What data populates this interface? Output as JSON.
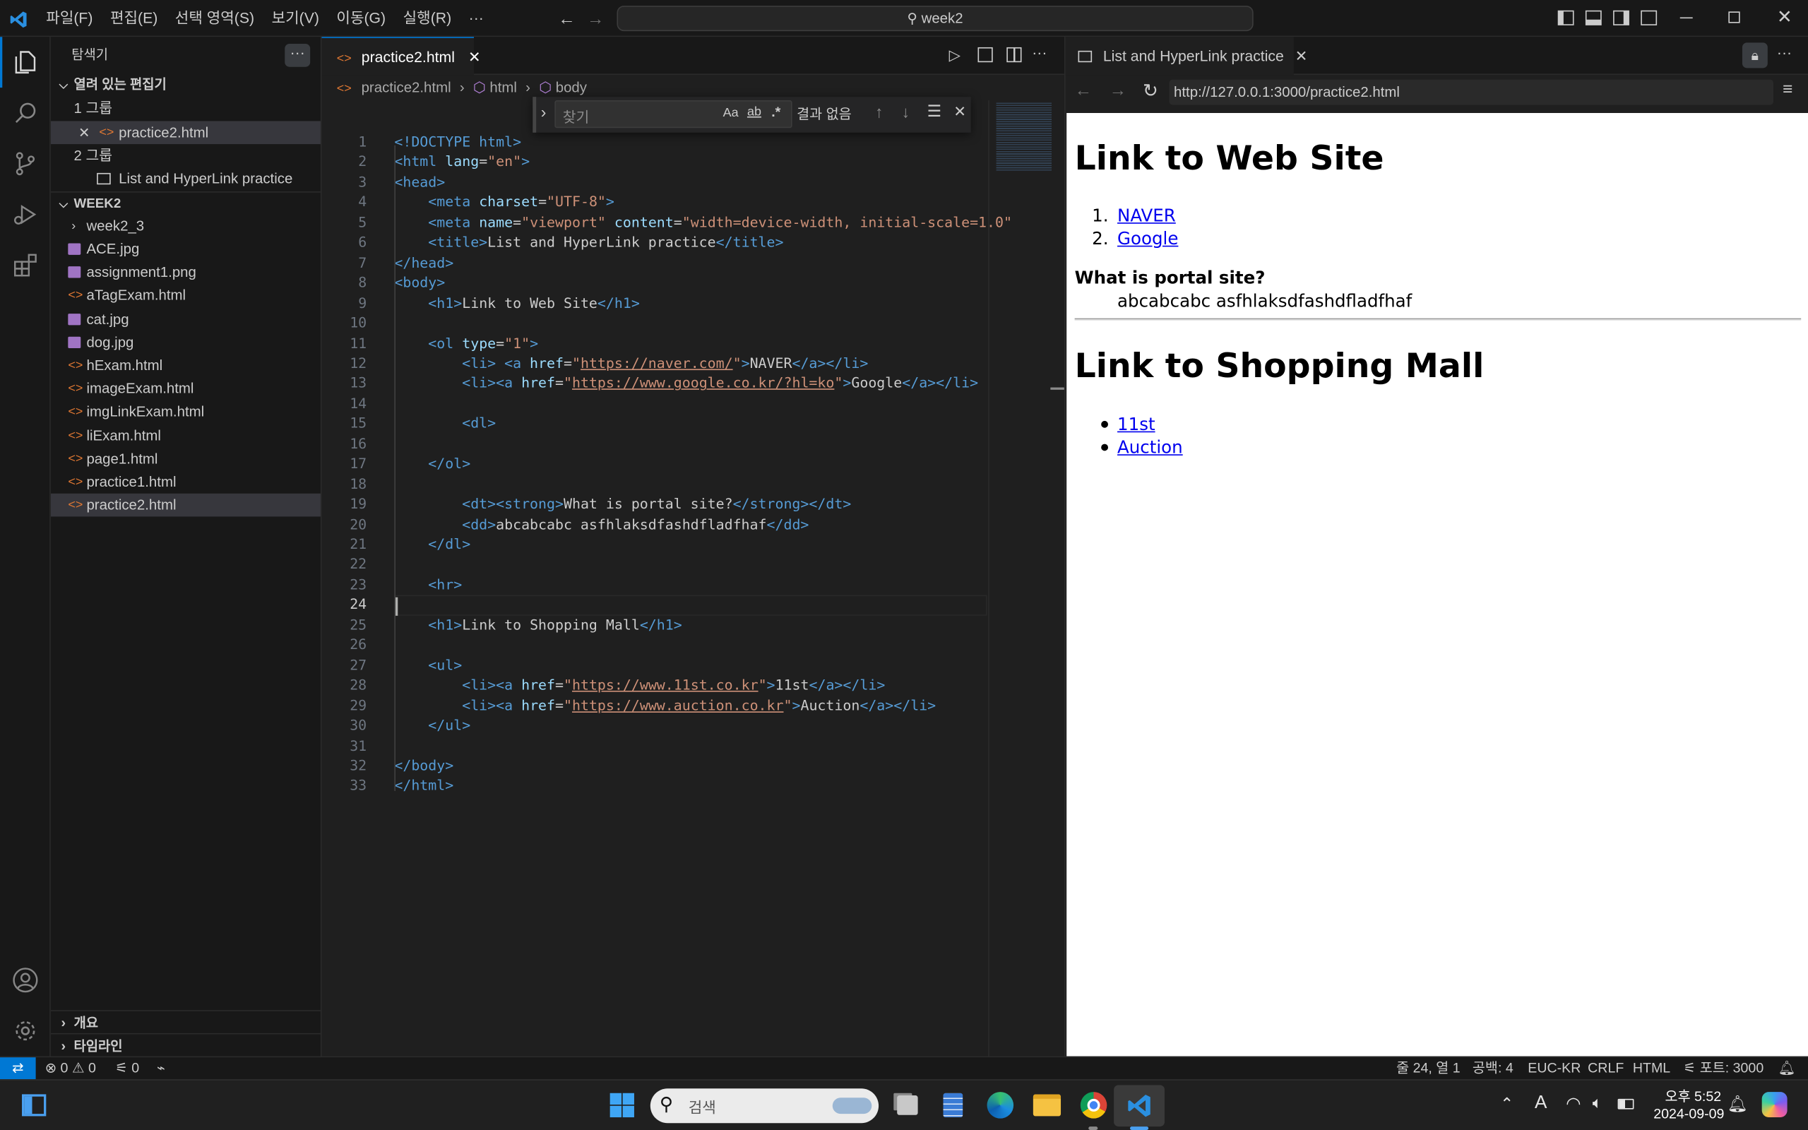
{
  "titlebar": {
    "menus": [
      "파일(F)",
      "편집(E)",
      "선택 영역(S)",
      "보기(V)",
      "이동(G)",
      "실행(R)",
      "···"
    ],
    "search": "week2"
  },
  "sidebar": {
    "title": "탐색기",
    "open_editors": "열려 있는 편집기",
    "group1": "1 그룹",
    "group1_file": "practice2.html",
    "group2": "2 그룹",
    "group2_file": "List and HyperLink practice",
    "folder": "WEEK2",
    "subfolder": "week2_3",
    "files": [
      {
        "name": "ACE.jpg",
        "type": "image"
      },
      {
        "name": "assignment1.png",
        "type": "image"
      },
      {
        "name": "aTagExam.html",
        "type": "html"
      },
      {
        "name": "cat.jpg",
        "type": "image"
      },
      {
        "name": "dog.jpg",
        "type": "image"
      },
      {
        "name": "hExam.html",
        "type": "html"
      },
      {
        "name": "imageExam.html",
        "type": "html"
      },
      {
        "name": "imgLinkExam.html",
        "type": "html"
      },
      {
        "name": "liExam.html",
        "type": "html"
      },
      {
        "name": "page1.html",
        "type": "html"
      },
      {
        "name": "practice1.html",
        "type": "html"
      },
      {
        "name": "practice2.html",
        "type": "html"
      }
    ],
    "outline": "개요",
    "timeline": "타임라인"
  },
  "editor": {
    "tab": "practice2.html",
    "breadcrumb": [
      "practice2.html",
      "html",
      "body"
    ],
    "find": {
      "placeholder": "찾기",
      "result": "결과 없음",
      "opt_case": "Aa",
      "opt_word": "ab",
      "opt_regex": ".*"
    },
    "lines": [
      [
        [
          "t",
          "<!DOCTYPE html>"
        ]
      ],
      [
        [
          "t",
          "<html "
        ],
        [
          "a",
          "lang"
        ],
        [
          "d",
          "="
        ],
        [
          "s",
          "\"en\""
        ],
        [
          "t",
          ">"
        ]
      ],
      [
        [
          "t",
          "<head>"
        ]
      ],
      [
        [
          "d",
          "    "
        ],
        [
          "t",
          "<meta "
        ],
        [
          "a",
          "charset"
        ],
        [
          "d",
          "="
        ],
        [
          "s",
          "\"UTF-8\""
        ],
        [
          "t",
          ">"
        ]
      ],
      [
        [
          "d",
          "    "
        ],
        [
          "t",
          "<meta "
        ],
        [
          "a",
          "name"
        ],
        [
          "d",
          "="
        ],
        [
          "s",
          "\"viewport\""
        ],
        [
          "d",
          " "
        ],
        [
          "a",
          "content"
        ],
        [
          "d",
          "="
        ],
        [
          "s",
          "\"width=device-width, initial-scale=1.0\""
        ]
      ],
      [
        [
          "d",
          "    "
        ],
        [
          "t",
          "<title>"
        ],
        [
          "d",
          "List and HyperLink practice"
        ],
        [
          "t",
          "</title>"
        ]
      ],
      [
        [
          "t",
          "</head>"
        ]
      ],
      [
        [
          "t",
          "<body>"
        ]
      ],
      [
        [
          "d",
          "    "
        ],
        [
          "t",
          "<h1>"
        ],
        [
          "d",
          "Link to Web Site"
        ],
        [
          "t",
          "</h1>"
        ]
      ],
      [],
      [
        [
          "d",
          "    "
        ],
        [
          "t",
          "<ol "
        ],
        [
          "a",
          "type"
        ],
        [
          "d",
          "="
        ],
        [
          "s",
          "\"1\""
        ],
        [
          "t",
          ">"
        ]
      ],
      [
        [
          "d",
          "        "
        ],
        [
          "t",
          "<li> <a "
        ],
        [
          "a",
          "href"
        ],
        [
          "d",
          "="
        ],
        [
          "s",
          "\""
        ],
        [
          "su",
          "https://naver.com/"
        ],
        [
          "s",
          "\""
        ],
        [
          "t",
          ">"
        ],
        [
          "d",
          "NAVER"
        ],
        [
          "t",
          "</a></li>"
        ]
      ],
      [
        [
          "d",
          "        "
        ],
        [
          "t",
          "<li><a "
        ],
        [
          "a",
          "href"
        ],
        [
          "d",
          "="
        ],
        [
          "s",
          "\""
        ],
        [
          "su",
          "https://www.google.co.kr/?hl=ko"
        ],
        [
          "s",
          "\""
        ],
        [
          "t",
          ">"
        ],
        [
          "d",
          "Google"
        ],
        [
          "t",
          "</a></li>"
        ]
      ],
      [],
      [
        [
          "d",
          "        "
        ],
        [
          "t",
          "<dl>"
        ]
      ],
      [],
      [
        [
          "d",
          "    "
        ],
        [
          "t",
          "</ol>"
        ]
      ],
      [],
      [
        [
          "d",
          "        "
        ],
        [
          "t",
          "<dt><strong>"
        ],
        [
          "d",
          "What is portal site?"
        ],
        [
          "t",
          "</strong></dt>"
        ]
      ],
      [
        [
          "d",
          "        "
        ],
        [
          "t",
          "<dd>"
        ],
        [
          "d",
          "abcabcabc asfhlaksdfashdfladfhaf"
        ],
        [
          "t",
          "</dd>"
        ]
      ],
      [
        [
          "d",
          "    "
        ],
        [
          "t",
          "</dl>"
        ]
      ],
      [],
      [
        [
          "d",
          "    "
        ],
        [
          "t",
          "<hr>"
        ]
      ],
      [],
      [
        [
          "d",
          "    "
        ],
        [
          "t",
          "<h1>"
        ],
        [
          "d",
          "Link to Shopping Mall"
        ],
        [
          "t",
          "</h1>"
        ]
      ],
      [],
      [
        [
          "d",
          "    "
        ],
        [
          "t",
          "<ul>"
        ]
      ],
      [
        [
          "d",
          "        "
        ],
        [
          "t",
          "<li><a "
        ],
        [
          "a",
          "href"
        ],
        [
          "d",
          "="
        ],
        [
          "s",
          "\""
        ],
        [
          "su",
          "https://www.11st.co.kr"
        ],
        [
          "s",
          "\""
        ],
        [
          "t",
          ">"
        ],
        [
          "d",
          "11st"
        ],
        [
          "t",
          "</a></li>"
        ]
      ],
      [
        [
          "d",
          "        "
        ],
        [
          "t",
          "<li><a "
        ],
        [
          "a",
          "href"
        ],
        [
          "d",
          "="
        ],
        [
          "s",
          "\""
        ],
        [
          "su",
          "https://www.auction.co.kr"
        ],
        [
          "s",
          "\""
        ],
        [
          "t",
          ">"
        ],
        [
          "d",
          "Auction"
        ],
        [
          "t",
          "</a></li>"
        ]
      ],
      [
        [
          "d",
          "    "
        ],
        [
          "t",
          "</ul>"
        ]
      ],
      [],
      [
        [
          "t",
          "</body>"
        ]
      ],
      [
        [
          "t",
          "</html>"
        ]
      ]
    ],
    "current_line": 24
  },
  "preview": {
    "tab": "List and HyperLink practice",
    "url": "http://127.0.0.1:3000/practice2.html",
    "h1_a": "Link to Web Site",
    "ol": [
      "NAVER",
      "Google"
    ],
    "ol_markers": [
      "1.",
      "2."
    ],
    "dt": "What is portal site?",
    "dd": "abcabcabc asfhlaksdfashdfladfhaf",
    "h1_b": "Link to Shopping Mall",
    "ul": [
      "11st",
      "Auction"
    ]
  },
  "status": {
    "errors": "0",
    "warnings": "0",
    "ports": "0",
    "position": "줄 24, 열 1",
    "spaces": "공백: 4",
    "encoding": "EUC-KR",
    "eol": "CRLF",
    "language": "HTML",
    "port": "포트: 3000"
  },
  "taskbar": {
    "search": "검색",
    "time": "오후 5:52",
    "date": "2024-09-09",
    "ime": "A"
  },
  "colors": {
    "accent": "#0078d4",
    "tag": "#569cd6",
    "attr": "#9cdcfe",
    "string": "#ce9178",
    "link": "#0000ee"
  }
}
